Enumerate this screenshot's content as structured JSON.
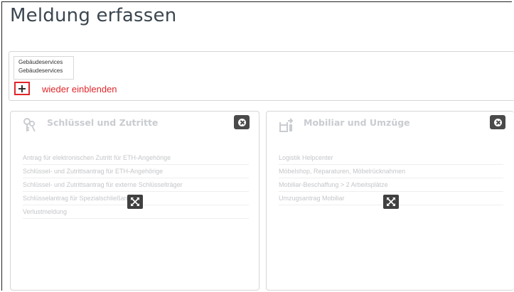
{
  "page": {
    "title": "Meldung erfassen"
  },
  "hidden_services": {
    "items": [
      "Gebäudeservices",
      "Gebäudeservices"
    ],
    "show_button_icon": "plus-icon",
    "show_label": "wieder einblenden"
  },
  "cards": [
    {
      "title": "Schlüssel und Zutritte",
      "icon": "keys-icon",
      "links": [
        "Antrag für elektronischen Zutritt für ETH-Angehörige",
        "Schlüssel- und Zutrittsantrag für ETH-Angehörige",
        "Schlüssel- und Zutrittsantrag für externe Schlüsselträger",
        "Schlüsselantrag für Spezialschließanlagen",
        "Verlustmeldung"
      ]
    },
    {
      "title": "Mobiliar und Umzüge",
      "icon": "furniture-move-icon",
      "links": [
        "Logistik Helpcenter",
        "Möbelshop, Reparaturen, Möbelrücknahmen",
        "Mobiliar-Beschaffung > 2 Arbeitsplätze",
        "Umzugsantrag Mobiliar"
      ]
    }
  ],
  "colors": {
    "accent_red": "#e0262b",
    "title_text": "#3b4650",
    "muted_text": "#c4c6c9",
    "control_dark": "#4a4a4a"
  }
}
